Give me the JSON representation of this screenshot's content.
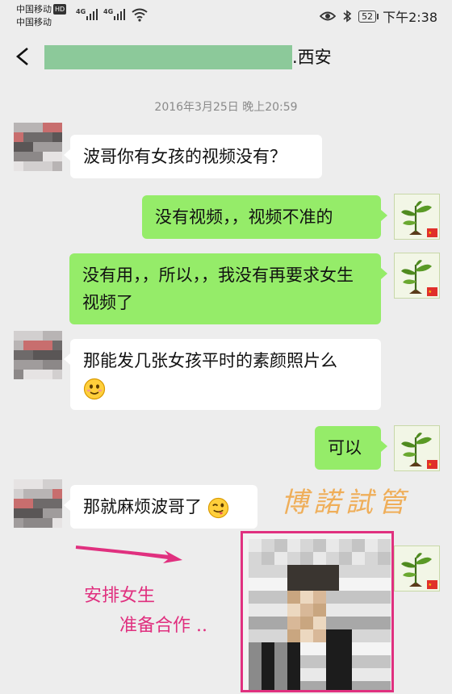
{
  "status_bar": {
    "carrier_1": "中国移动",
    "carrier_1_badge": "HD",
    "carrier_2": "中国移动",
    "network_1": "4G",
    "network_2": "4G",
    "battery": "52",
    "time": "下午2:38",
    "icons": [
      "eye-icon",
      "bluetooth-icon",
      "wifi-icon",
      "signal-icon"
    ]
  },
  "nav": {
    "back_icon": "back-arrow-icon",
    "title_suffix": ".西安"
  },
  "chat": {
    "timestamp": "2016年3月25日 晚上20:59",
    "messages": [
      {
        "side": "in",
        "text": "波哥你有女孩的视频没有？"
      },
      {
        "side": "out",
        "text": "没有视频，，视频不准的"
      },
      {
        "side": "out",
        "text": "没有用，，所以，，我没有再要求女生视频了"
      },
      {
        "side": "in",
        "text": "那能发几张女孩平时的素颜照片么",
        "emoji": "smile-emoji"
      },
      {
        "side": "out",
        "text": "可以"
      },
      {
        "side": "in",
        "text": "那就麻烦波哥了",
        "emoji": "wink-tongue-emoji"
      },
      {
        "side": "out",
        "type": "image",
        "content": "pixelated-photo"
      }
    ]
  },
  "annotations": {
    "watermark": "博諾試管",
    "note_line_1": "安排女生",
    "note_line_2": "准备合作 ..",
    "accent_color": "#e0307f",
    "watermark_color": "#f0a84a"
  },
  "colors": {
    "background": "#ededed",
    "bubble_out": "#95ec69",
    "bubble_in": "#ffffff"
  }
}
